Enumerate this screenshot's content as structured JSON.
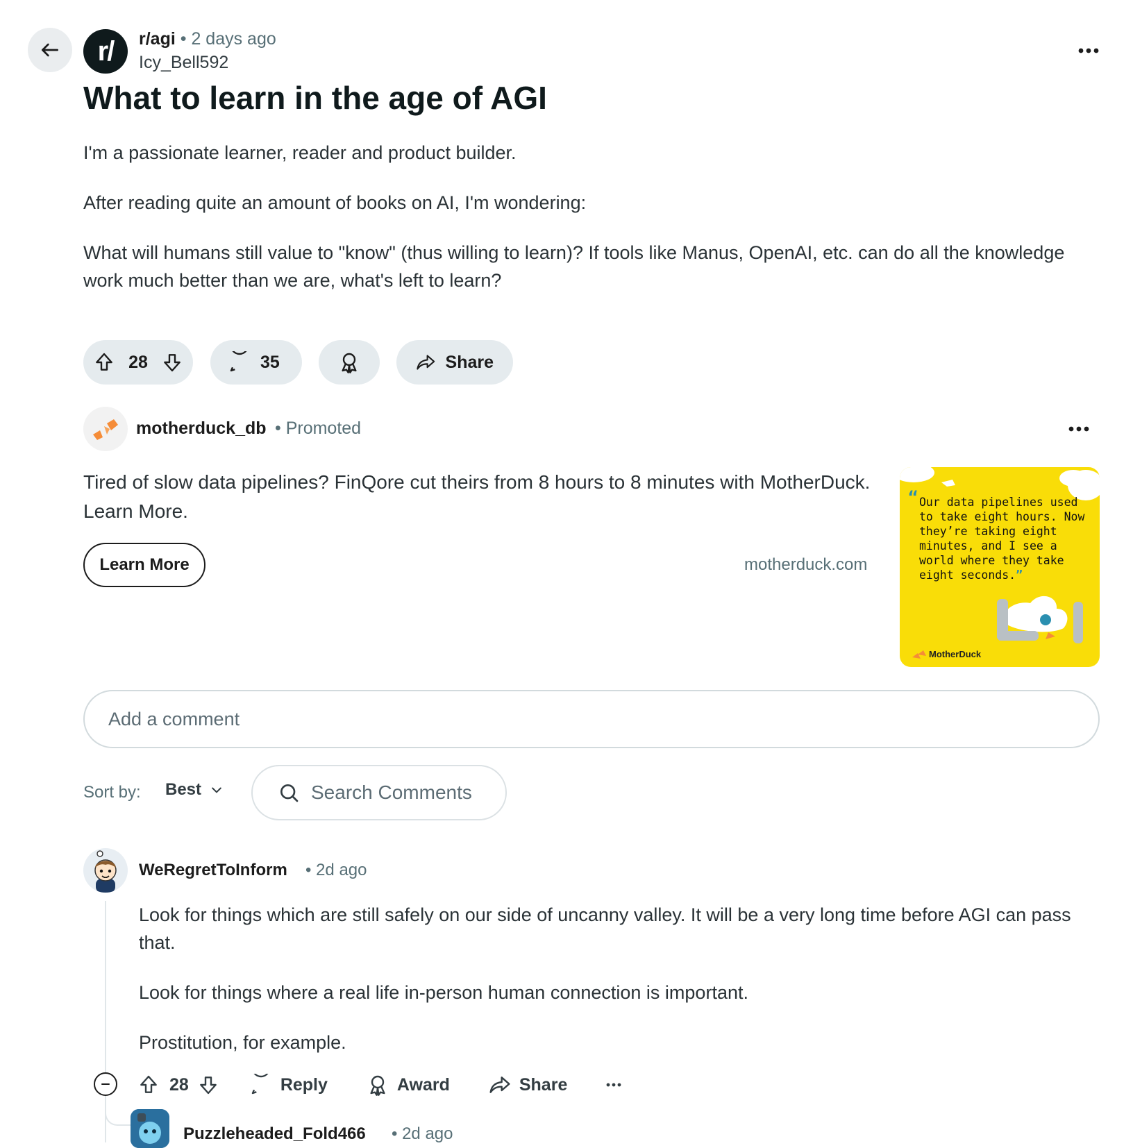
{
  "post": {
    "subreddit": "r/agi",
    "subreddit_avatar_text": "r/",
    "time": "2 days ago",
    "author": "Icy_Bell592",
    "title": "What to learn in the age of AGI",
    "body": [
      "I'm a passionate learner, reader and product builder.",
      "After reading quite an amount of books on AI, I'm wondering:",
      "What will humans still value to \"know\" (thus willing to learn)? If tools like Manus, OpenAI, etc. can do all the knowledge work much better than we are, what's left to learn?"
    ],
    "votes": "28",
    "comments": "35",
    "share_label": "Share"
  },
  "ad": {
    "advertiser": "motherduck_db",
    "promoted_label": "Promoted",
    "text": "Tired of slow data pipelines? FinQore cut theirs from 8 hours to 8 minutes with MotherDuck. Learn More.",
    "cta_label": "Learn More",
    "domain": "motherduck.com",
    "image_quote_open": "“",
    "image_quote": "Our data pipelines used to take eight hours. Now they’re taking eight minutes, and I see a world where they take eight seconds.",
    "image_quote_close": "”",
    "image_brand": "MotherDuck",
    "image_bg": "#f9dd08"
  },
  "comment_box": {
    "placeholder": "Add a comment"
  },
  "sort": {
    "label": "Sort by:",
    "value": "Best"
  },
  "search": {
    "placeholder": "Search Comments"
  },
  "comments": [
    {
      "author": "WeRegretToInform",
      "time": "2d ago",
      "body": [
        "Look for things which are still safely on our side of uncanny valley. It will be a very long time before AGI can pass that.",
        "Look for things where a real life in-person human connection is important.",
        "Prostitution, for example."
      ],
      "votes": "28",
      "reply_label": "Reply",
      "award_label": "Award",
      "share_label": "Share"
    }
  ],
  "reply_preview": {
    "author": "Puzzleheaded_Fold466",
    "time": "2d ago"
  },
  "colors": {
    "pill_bg": "#e5ebee",
    "meta_text": "#576f76",
    "accent_orange": "#f58c38"
  }
}
